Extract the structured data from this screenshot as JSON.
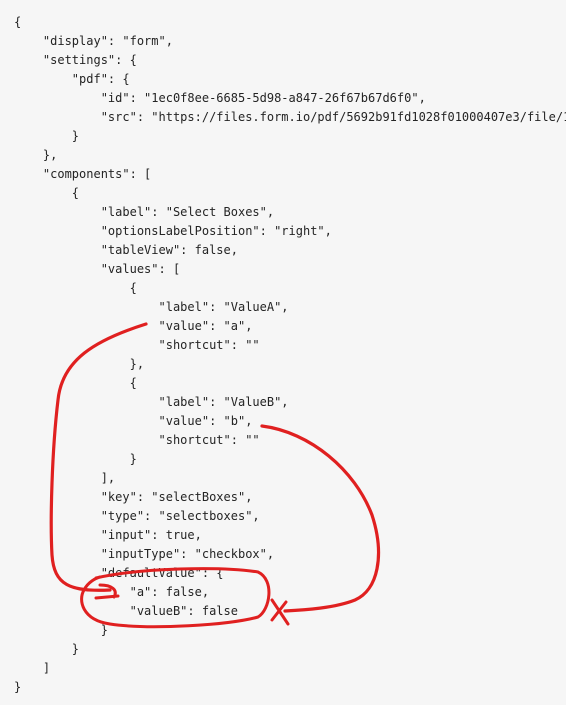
{
  "code": {
    "language": "json",
    "lines": [
      "{",
      "    \"display\": \"form\",",
      "    \"settings\": {",
      "        \"pdf\": {",
      "            \"id\": \"1ec0f8ee-6685-5d98-a847-26f67b67d6f0\",",
      "            \"src\": \"https://files.form.io/pdf/5692b91fd1028f01000407e3/file/1",
      "        }",
      "    },",
      "    \"components\": [",
      "        {",
      "            \"label\": \"Select Boxes\",",
      "            \"optionsLabelPosition\": \"right\",",
      "            \"tableView\": false,",
      "            \"values\": [",
      "                {",
      "                    \"label\": \"ValueA\",",
      "                    \"value\": \"a\",",
      "                    \"shortcut\": \"\"",
      "                },",
      "                {",
      "                    \"label\": \"ValueB\",",
      "                    \"value\": \"b\",",
      "                    \"shortcut\": \"\"",
      "                }",
      "            ],",
      "            \"key\": \"selectBoxes\",",
      "            \"type\": \"selectboxes\",",
      "            \"input\": true,",
      "            \"inputType\": \"checkbox\",",
      "            \"defaultValue\": {",
      "                \"a\": false,",
      "                \"valueB\": false",
      "            }",
      "        }",
      "    ]",
      "}"
    ]
  },
  "annotation": {
    "color": "#e02020",
    "description_marks": [
      "circle-around-defaultValue",
      "arrow-from-value-a",
      "arrow-from-value-b",
      "x-mark"
    ]
  }
}
